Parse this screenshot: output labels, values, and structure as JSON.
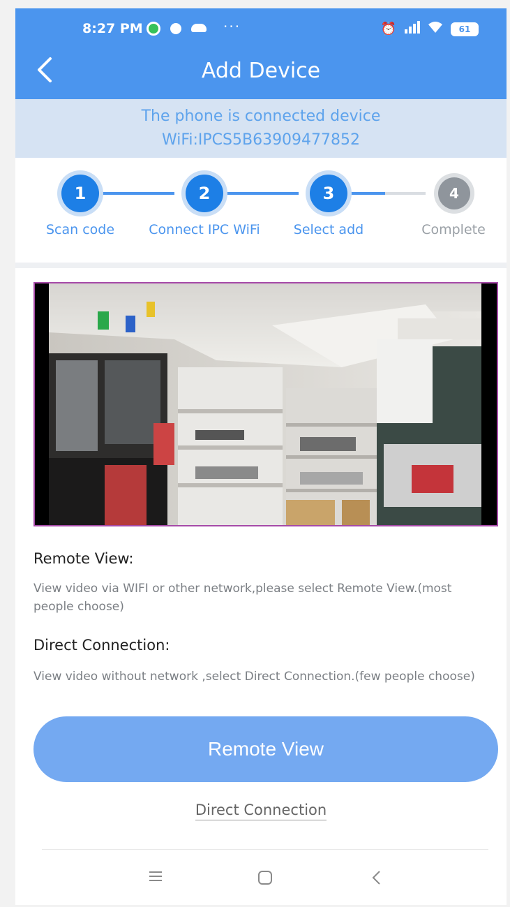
{
  "status_bar": {
    "time": "8:27 PM",
    "dots": "···",
    "battery": "61",
    "icons": [
      "alarm-icon",
      "signal-icon",
      "wifi-icon",
      "battery-icon"
    ]
  },
  "header": {
    "title": "Add Device",
    "back_icon": "chevron-left-icon"
  },
  "banner": {
    "line1": "The phone is connected device",
    "line2": "WiFi:IPCS5B63909477852"
  },
  "steps": [
    {
      "number": "1",
      "label": "Scan code",
      "state": "done"
    },
    {
      "number": "2",
      "label": "Connect IPC WiFi",
      "state": "done"
    },
    {
      "number": "3",
      "label": "Select add",
      "state": "current"
    },
    {
      "number": "4",
      "label": "Complete",
      "state": "pending"
    }
  ],
  "content": {
    "remote_title": "Remote View:",
    "remote_desc": "View video via WIFI or other network,please select Remote View.(most people choose)",
    "direct_title": "Direct Connection:",
    "direct_desc": "View video without network ,select Direct Connection.(few people choose)"
  },
  "actions": {
    "primary_label": "Remote View",
    "secondary_label": "Direct Connection"
  },
  "nav": {
    "menu_icon": "menu-icon",
    "home_icon": "home-square-icon",
    "back_icon": "back-chevron-icon"
  },
  "colors": {
    "accent": "#4b95ee",
    "step_active": "#1d7fe6",
    "button": "#74a9f1",
    "banner_bg": "#d6e3f3"
  }
}
